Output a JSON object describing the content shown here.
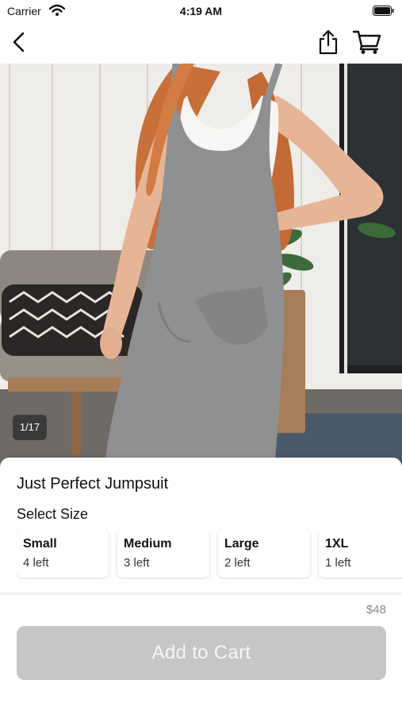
{
  "status_bar": {
    "carrier": "Carrier",
    "time": "4:19 AM",
    "icons": [
      "wifi-icon",
      "battery-icon"
    ]
  },
  "nav": {
    "icons": [
      "back-chevron-icon",
      "share-icon",
      "cart-icon"
    ]
  },
  "gallery": {
    "counter": "1/17",
    "image_alt": "Woman wearing a heather grey jumpsuit over a white tank top"
  },
  "product": {
    "title": "Just Perfect Jumpsuit",
    "size_heading": "Select Size",
    "sizes": [
      {
        "name": "Small",
        "stock": "4 left"
      },
      {
        "name": "Medium",
        "stock": "3 left"
      },
      {
        "name": "Large",
        "stock": "2 left"
      },
      {
        "name": "1XL",
        "stock": "1 left"
      }
    ],
    "price": "$48",
    "add_to_cart_label": "Add to Cart"
  },
  "colors": {
    "button_disabled": "#c6c6c6",
    "jumpsuit_grey": "#8f9092",
    "hair": "#c8703a"
  }
}
